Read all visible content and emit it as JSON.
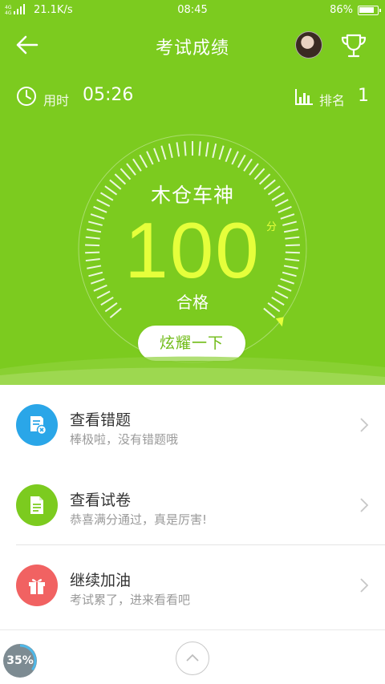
{
  "status_bar": {
    "network_type": "4G 4G",
    "speed": "21.1K/s",
    "time": "08:45",
    "battery": "86%",
    "battery_level": 0.86
  },
  "nav": {
    "title": "考试成绩"
  },
  "stats": {
    "time_label": "用时",
    "time_value": "05:26",
    "rank_label": "排名",
    "rank_value": "1"
  },
  "result": {
    "title": "木仓车神",
    "score": "100",
    "unit": "分",
    "status": "合格",
    "share_label": "炫耀一下",
    "gauge_fraction": 1.0
  },
  "items": [
    {
      "title": "查看错题",
      "subtitle": "棒极啦，没有错题哦",
      "color": "#2aa6e8",
      "icon": "wrong-questions-icon"
    },
    {
      "title": "查看试卷",
      "subtitle": "恭喜满分通过，真是厉害!",
      "color": "#7ccb1f",
      "icon": "exam-paper-icon"
    },
    {
      "title": "继续加油",
      "subtitle": "考试累了，进来看看吧",
      "color": "#f16262",
      "icon": "gift-icon"
    }
  ],
  "progress_ball": {
    "label": "35%",
    "value": 0.35
  },
  "colors": {
    "primary_green": "#7ccb1f",
    "score_yellow": "#e5ff3b"
  }
}
